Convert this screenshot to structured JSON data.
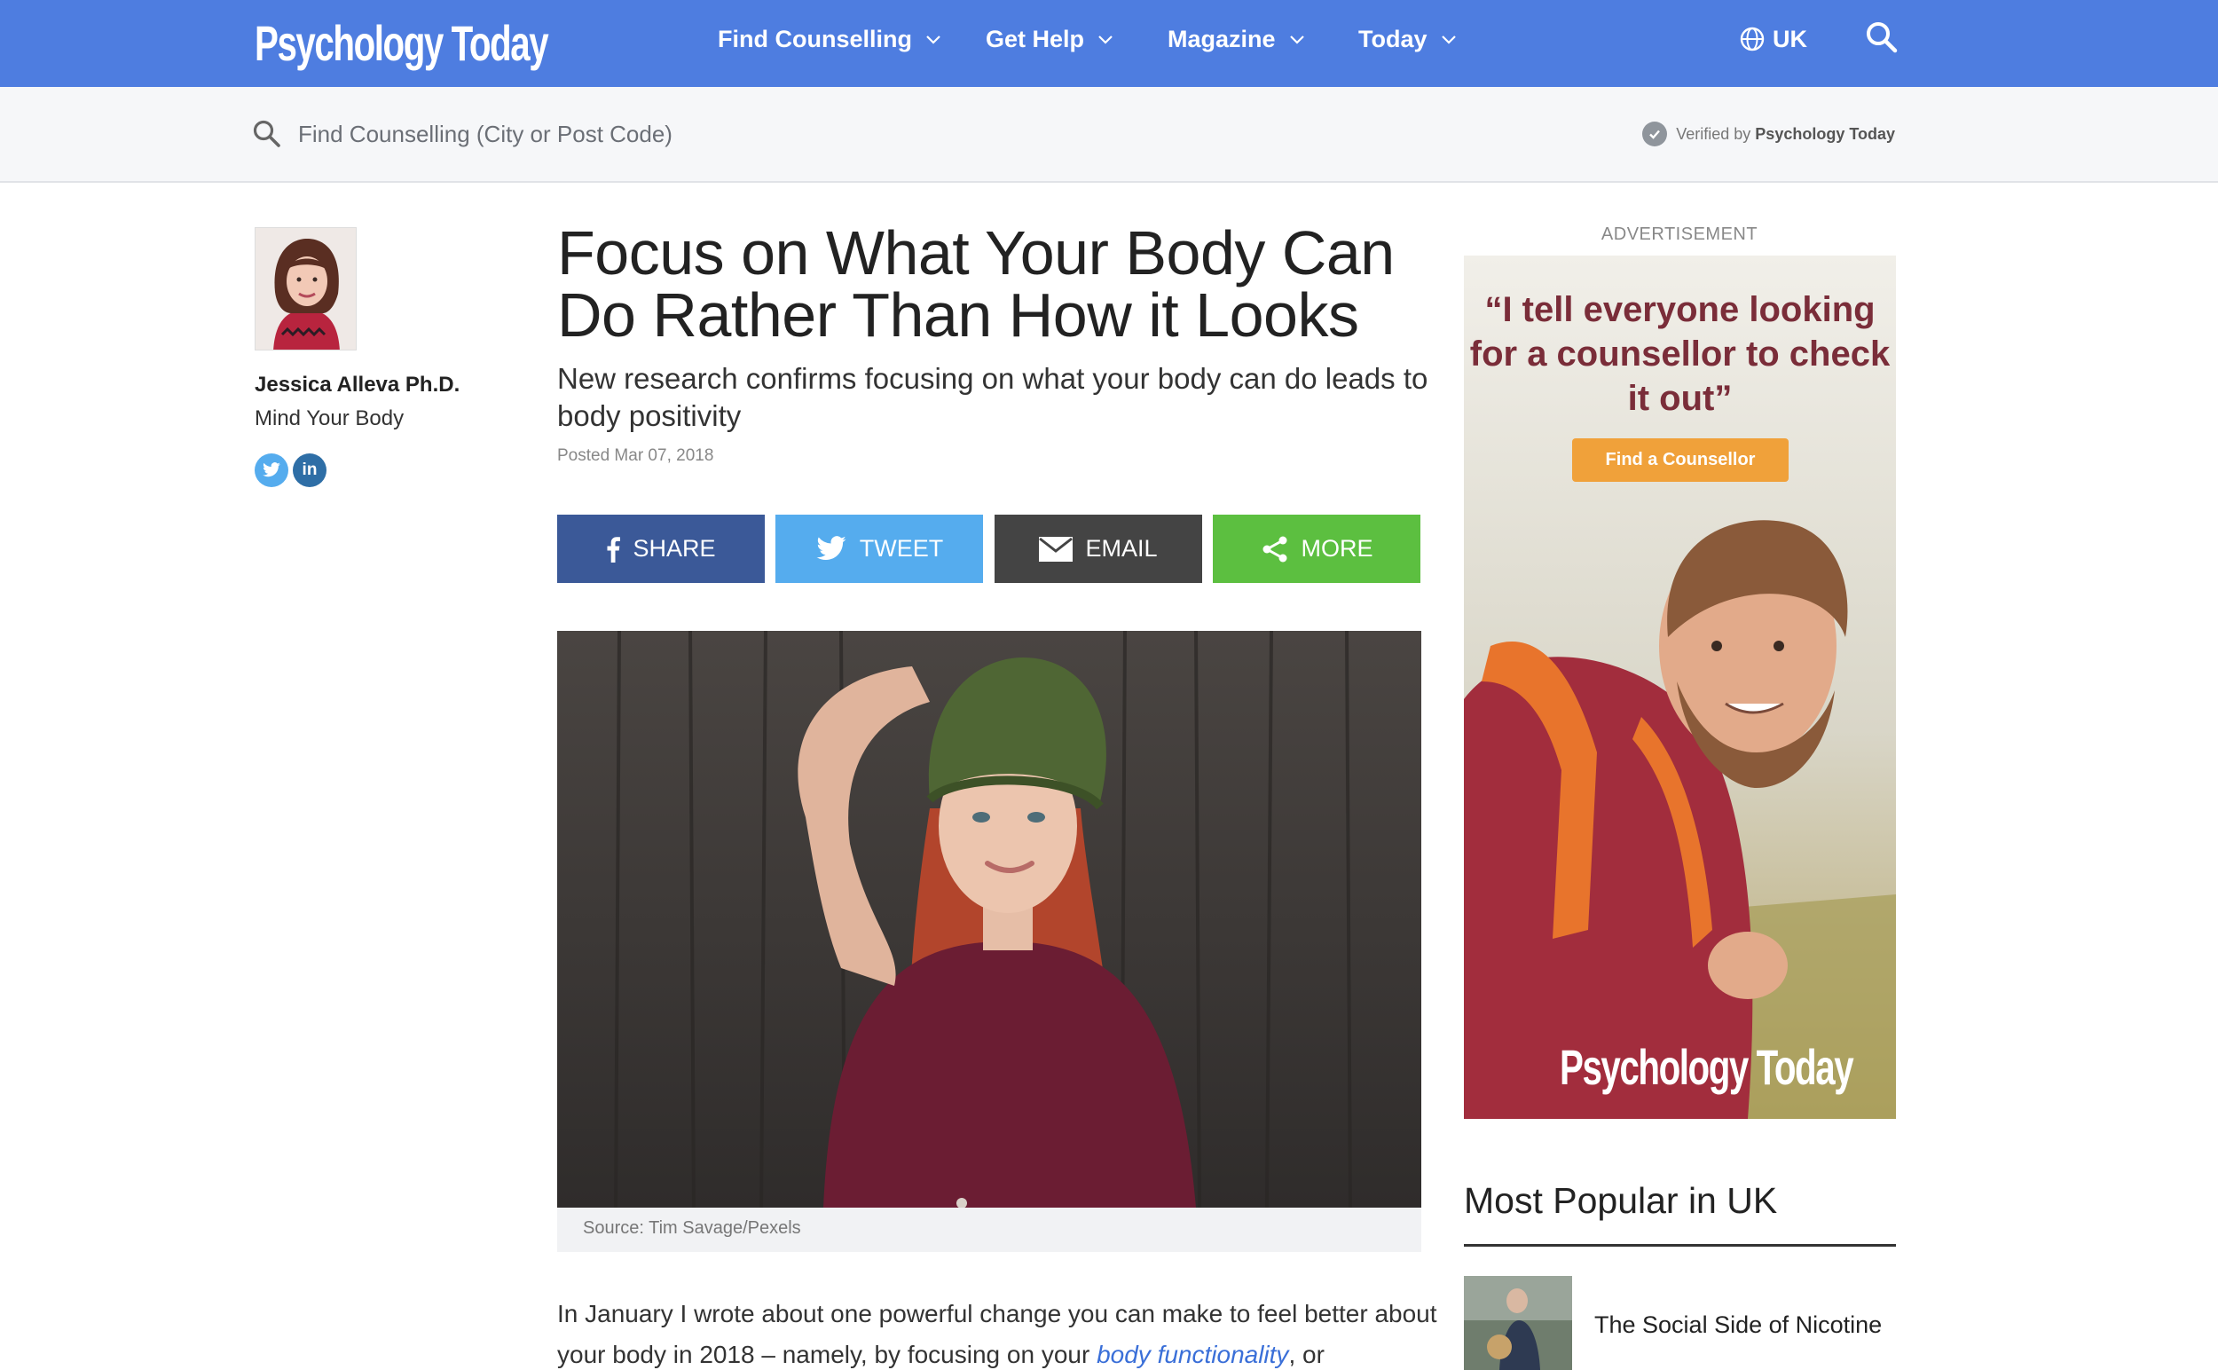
{
  "brand": {
    "logo": "Psychology Today"
  },
  "nav": {
    "items": [
      {
        "label": "Find Counselling"
      },
      {
        "label": "Get Help"
      },
      {
        "label": "Magazine"
      },
      {
        "label": "Today"
      }
    ],
    "region": "UK"
  },
  "search": {
    "placeholder": "Find Counselling (City or Post Code)",
    "verified_prefix": "Verified by",
    "verified_brand": "Psychology Today"
  },
  "author": {
    "name": "Jessica Alleva Ph.D.",
    "blog": "Mind Your Body",
    "social": {
      "linkedin_label": "in"
    }
  },
  "article": {
    "title": "Focus on What Your Body Can Do Rather Than How it Looks",
    "subtitle": "New research confirms focusing on what your body can do leads to body positivity",
    "posted": "Posted Mar 07, 2018",
    "share_buttons": [
      {
        "label": "SHARE",
        "color": "#3b5998"
      },
      {
        "label": "TWEET",
        "color": "#55acee"
      },
      {
        "label": "EMAIL",
        "color": "#444444"
      },
      {
        "label": "MORE",
        "color": "#5cbf40"
      }
    ],
    "image_caption": "Source: Tim Savage/Pexels",
    "body_start": "In January I wrote about one powerful change you can make to feel better about your body in 2018 – namely, by focusing on your ",
    "body_link": "body functionality",
    "body_end": ", or"
  },
  "ad": {
    "label": "ADVERTISEMENT",
    "quote": "“I tell everyone looking for a counsellor to check it out”",
    "button": "Find a Counsellor",
    "logo": "Psychology Today"
  },
  "popular": {
    "heading": "Most Popular in UK",
    "items": [
      {
        "title": "The Social Side of Nicotine"
      }
    ]
  },
  "colors": {
    "nav": "#4e7de0",
    "ad_quote": "#7a2d39",
    "ad_button": "#f0a13a",
    "link": "#3a6fd8"
  }
}
